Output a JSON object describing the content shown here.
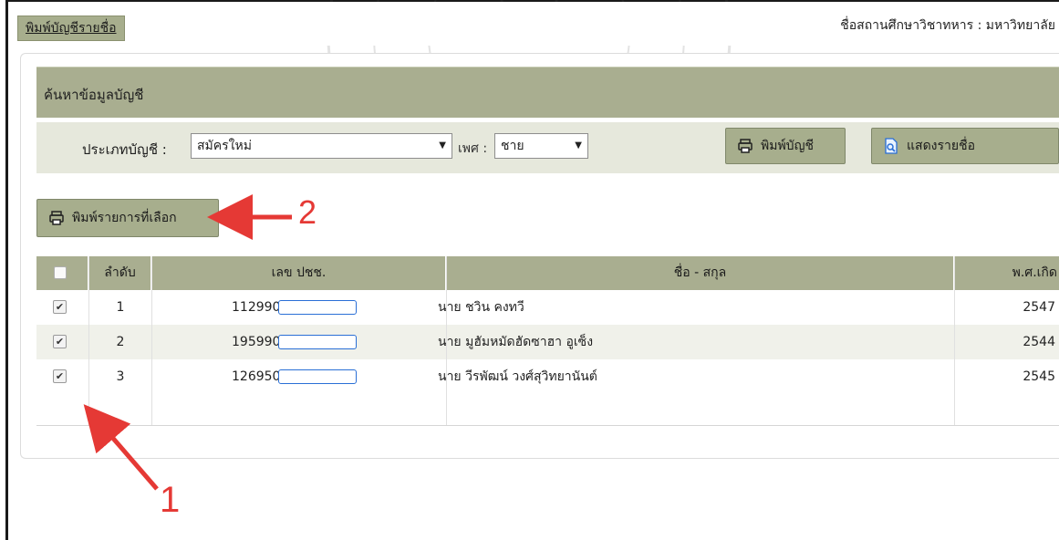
{
  "header": {
    "tab_label": "พิมพ์บัญชีรายชื่อ",
    "institution": "ชื่อสถานศึกษาวิชาทหาร : มหาวิทยาลัย"
  },
  "search": {
    "title": "ค้นหาข้อมูลบัญชี",
    "type_label": "ประเภทบัญชี :",
    "type_value": "สมัครใหม่",
    "gender_label": "เพศ :",
    "gender_value": "ชาย",
    "print_account_label": "พิมพ์บัญชี",
    "show_list_label": "แสดงรายชื่อ"
  },
  "actions": {
    "print_selected_label": "พิมพ์รายการที่เลือก"
  },
  "table": {
    "columns": [
      "ลำดับ",
      "เลข ปชช.",
      "ชื่อ - สกุล",
      "พ.ศ.เกิด"
    ],
    "rows": [
      {
        "checked": true,
        "seq": "1",
        "id_prefix": "112990",
        "name": "นาย ชวิน  คงทวี",
        "year": "2547"
      },
      {
        "checked": true,
        "seq": "2",
        "id_prefix": "195990",
        "name": "นาย มูฮัมหมัดฮัดซาฮา  อูเซ็ง",
        "year": "2544"
      },
      {
        "checked": true,
        "seq": "3",
        "id_prefix": "126950",
        "name": "นาย วีรพัฒน์  วงศ์สุวิทยานันต์",
        "year": "2545"
      }
    ]
  },
  "annotations": {
    "step_1": "1",
    "step_2": "2",
    "arrow_color": "#e53935"
  },
  "colors": {
    "header_bg": "#a9ae90",
    "row_alt": "#f0f1ea"
  }
}
